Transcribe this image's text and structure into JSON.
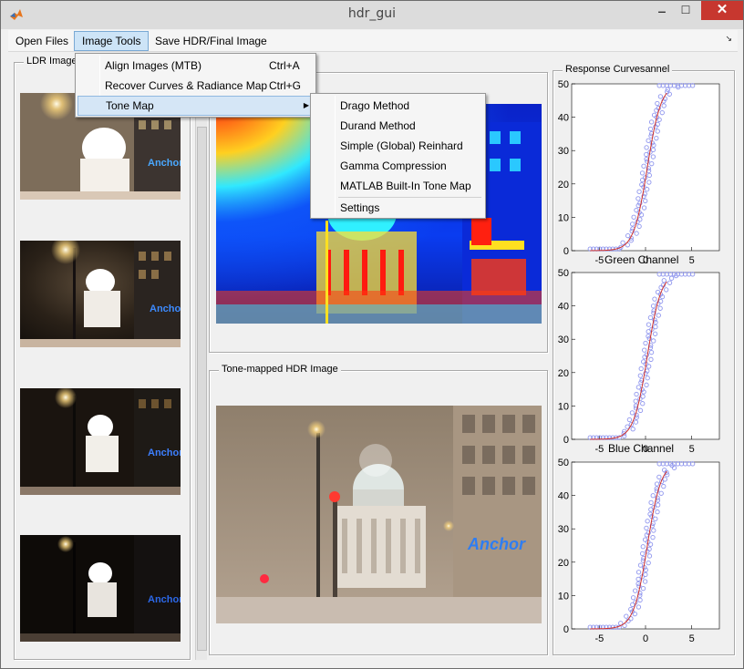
{
  "window": {
    "title": "hdr_gui",
    "minimize_glyph": "‒",
    "maximize_glyph": "☐",
    "close_glyph": "✕"
  },
  "menubar": {
    "items": [
      "Open Files",
      "Image Tools",
      "Save HDR/Final Image"
    ],
    "corner_glyph": "↘"
  },
  "image_tools_menu": {
    "items": [
      {
        "label": "Align Images (MTB)",
        "shortcut": "Ctrl+A"
      },
      {
        "label": "Recover Curves & Radiance Map",
        "shortcut": "Ctrl+G"
      },
      {
        "label": "Tone Map",
        "shortcut": ""
      }
    ],
    "submenu_arrow": "▶"
  },
  "tone_map_menu": {
    "items": [
      "Drago Method",
      "Durand Method",
      "Simple (Global) Reinhard",
      "Gamma Compression",
      "MATLAB Built-In Tone Map"
    ],
    "settings": "Settings"
  },
  "panels": {
    "ldr_title": "LDR Image",
    "tone_mapped_title": "Tone-mapped HDR Image",
    "response_title": "Response Curves",
    "response_title_tail": "annel"
  },
  "response_plots": [
    {
      "title": "",
      "yticks": [
        "50",
        "40",
        "30",
        "20",
        "10",
        "0"
      ],
      "xticks": [
        "-5",
        "0",
        "5"
      ]
    },
    {
      "title": "Green Channel",
      "yticks": [
        "50",
        "40",
        "30",
        "20",
        "10",
        "0"
      ],
      "xticks": [
        "-5",
        "0",
        "5"
      ]
    },
    {
      "title": "Blue Channel",
      "yticks": [
        "50",
        "40",
        "30",
        "20",
        "10",
        "0"
      ],
      "xticks": [
        "-5",
        "0",
        "5"
      ]
    }
  ],
  "colors": {
    "curve": "#d0302a",
    "samples": "#8f96ee",
    "close_button": "#c7372f",
    "menu_highlight": "#d5e6f6"
  }
}
